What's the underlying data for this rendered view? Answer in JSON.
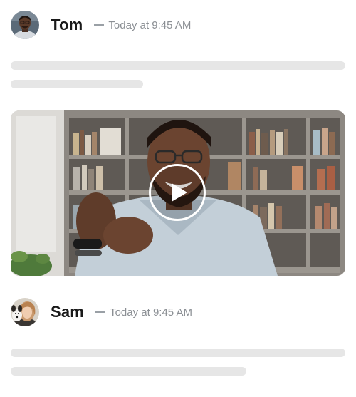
{
  "messages": [
    {
      "author": "Tom",
      "timestamp": "Today at 9:45 AM",
      "avatar_icon": "person-avatar-icon"
    },
    {
      "author": "Sam",
      "timestamp": "Today at 9:45 AM",
      "avatar_icon": "person-avatar-icon"
    }
  ],
  "video": {
    "play_icon": "play-icon"
  },
  "colors": {
    "author_text": "#1a1a1a",
    "meta_text": "#8b8f94",
    "skeleton": "#e6e6e6"
  }
}
